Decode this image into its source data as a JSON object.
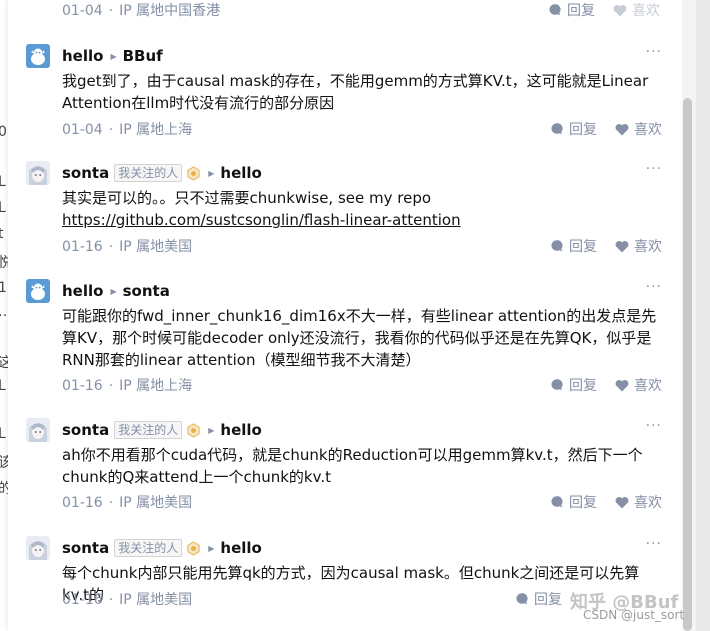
{
  "top_partial": {
    "date": "01-04",
    "location": "IP 属地中国香港",
    "reply_label": "回复",
    "like_label": "喜欢"
  },
  "comments": [
    {
      "author": "hello",
      "reply_to": "BBuf",
      "followed_tag": "",
      "text": "我get到了，由于causal mask的存在，不能用gemm的方式算KV.t，这可能就是Linear Attention在llm时代没有流行的部分原因",
      "date": "01-04",
      "location": "IP 属地上海",
      "reply_label": "回复",
      "like_label": "喜欢"
    },
    {
      "author": "sonta",
      "reply_to": "hello",
      "followed_tag": "我关注的人",
      "text_prefix": "其实是可以的。。只不过需要chunkwise, see my repo ",
      "link": "https://github.com/sustcsonglin/flash-linear-attention",
      "date": "01-16",
      "location": "IP 属地美国",
      "reply_label": "回复",
      "like_label": "喜欢"
    },
    {
      "author": "hello",
      "reply_to": "sonta",
      "followed_tag": "",
      "text": "可能跟你的fwd_inner_chunk16_dim16x不大一样，有些linear attention的出发点是先算KV，那个时候可能decoder only还没流行，我看你的代码似乎还是在先算QK，似乎是RNN那套的linear attention（模型细节我不大清楚）",
      "date": "01-16",
      "location": "IP 属地上海",
      "reply_label": "回复",
      "like_label": "喜欢"
    },
    {
      "author": "sonta",
      "reply_to": "hello",
      "followed_tag": "我关注的人",
      "text": "ah你不用看那个cuda代码，就是chunk的Reduction可以用gemm算kv.t，然后下一个chunk的Q来attend上一个chunk的kv.t",
      "date": "01-16",
      "location": "IP 属地美国",
      "reply_label": "回复",
      "like_label": "喜欢"
    },
    {
      "author": "sonta",
      "reply_to": "hello",
      "followed_tag": "我关注的人",
      "text": "每个chunk内部只能用先算qk的方式，因为causal mask。但chunk之间还是可以先算kv.t的",
      "date": "01-16",
      "location": "IP 属地美国",
      "reply_label": "回复",
      "like_label": ""
    }
  ],
  "meta_sep": "·",
  "more_glyph": "···",
  "left_peek_glyphs": [
    "0",
    "L",
    "L",
    "t",
    "悦",
    "1",
    "…",
    "这",
    "L",
    "L",
    "该",
    "的"
  ],
  "watermark": {
    "main": "知乎 @BBuf",
    "sub": "CSDN @just_sort"
  },
  "colors": {
    "text": "#121212",
    "meta": "#8590a6",
    "avatar_blue": "#5b9bd5",
    "badge_gold": "#e8b04a"
  }
}
